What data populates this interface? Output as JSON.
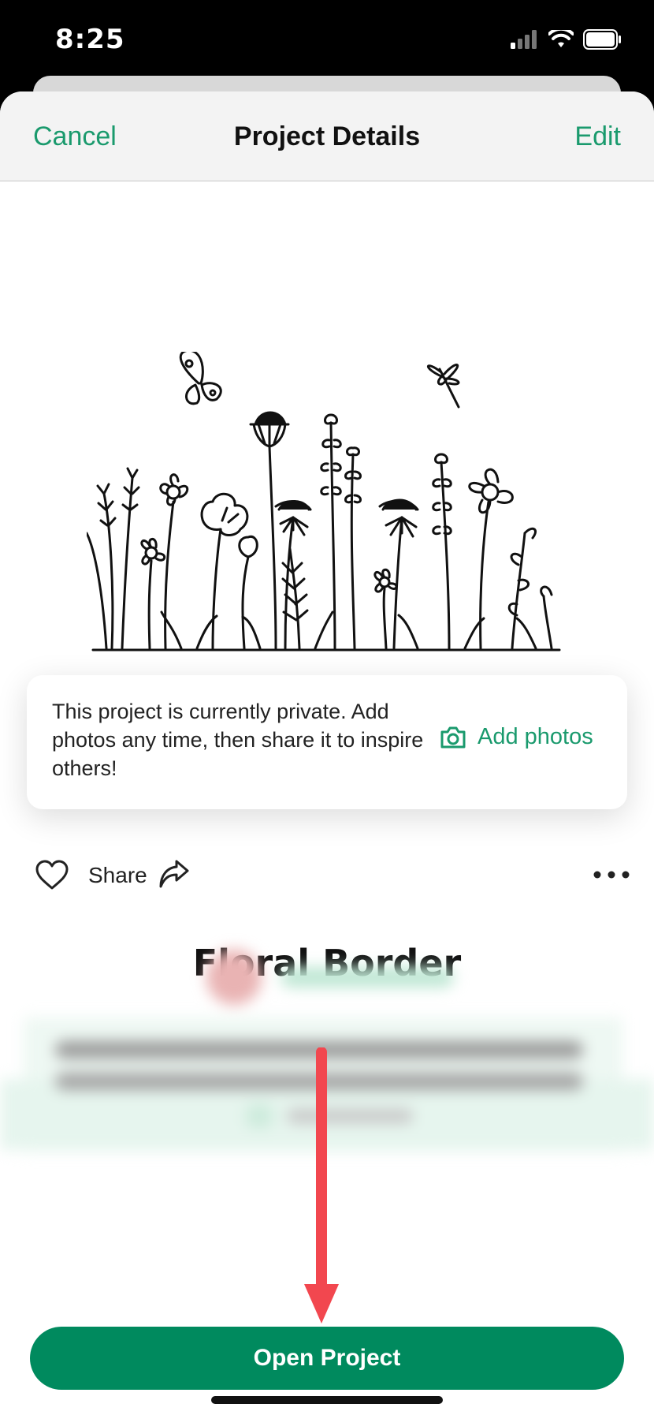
{
  "status_bar": {
    "time": "8:25"
  },
  "nav": {
    "cancel_label": "Cancel",
    "title": "Project Details",
    "edit_label": "Edit"
  },
  "notice": {
    "text": "This project is currently private. Add photos any time, then share it to inspire others!",
    "add_photos_label": "Add photos"
  },
  "actions": {
    "share_label": "Share"
  },
  "project": {
    "title": "Floral Border"
  },
  "footer": {
    "open_project_label": "Open Project"
  },
  "colors": {
    "accent": "#1a9a6d",
    "button": "#008a5e",
    "annotation_arrow": "#f2474f"
  },
  "icons": [
    "signal-icon",
    "wifi-icon",
    "battery-icon",
    "camera-icon",
    "heart-icon",
    "share-icon",
    "more-icon"
  ]
}
